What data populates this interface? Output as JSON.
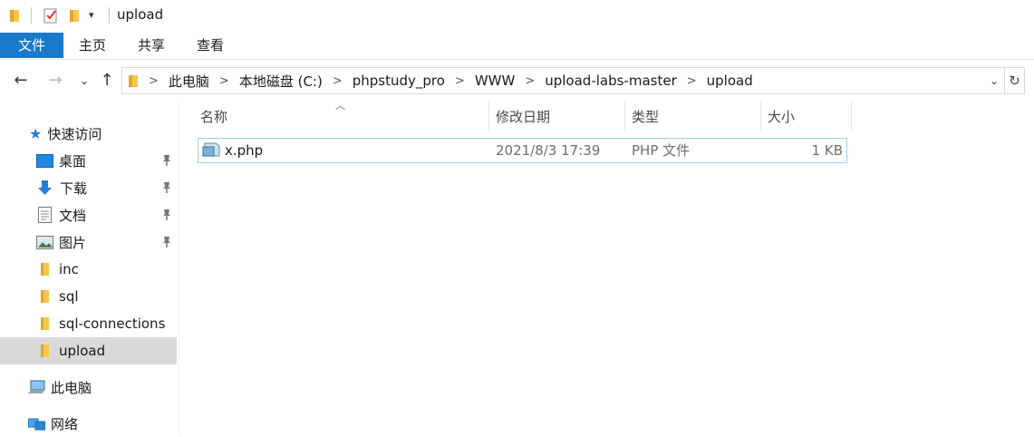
{
  "window": {
    "title": "upload"
  },
  "ribbon": {
    "tabs": [
      "文件",
      "主页",
      "共享",
      "查看"
    ]
  },
  "address": {
    "crumbs": [
      "此电脑",
      "本地磁盘 (C:)",
      "phpstudy_pro",
      "WWW",
      "upload-labs-master",
      "upload"
    ],
    "separator": ">"
  },
  "sidebar": {
    "quick_access": "快速访问",
    "pinned": [
      {
        "label": "桌面",
        "icon": "desktop-icon"
      },
      {
        "label": "下载",
        "icon": "download-arrow-icon"
      },
      {
        "label": "文档",
        "icon": "document-icon"
      },
      {
        "label": "图片",
        "icon": "picture-icon"
      }
    ],
    "folders": [
      "inc",
      "sql",
      "sql-connections",
      "upload"
    ],
    "selected": "upload",
    "this_pc": "此电脑",
    "network": "网络"
  },
  "columns": {
    "name": "名称",
    "modified": "修改日期",
    "type": "类型",
    "size": "大小"
  },
  "files": [
    {
      "name": "x.php",
      "modified": "2021/8/3 17:39",
      "type": "PHP 文件",
      "size": "1 KB"
    }
  ],
  "colors": {
    "accent": "#1979ca",
    "selection_border": "#99d1ff",
    "folder": "#f5c84c",
    "nav_selected": "#d9d9d9"
  }
}
